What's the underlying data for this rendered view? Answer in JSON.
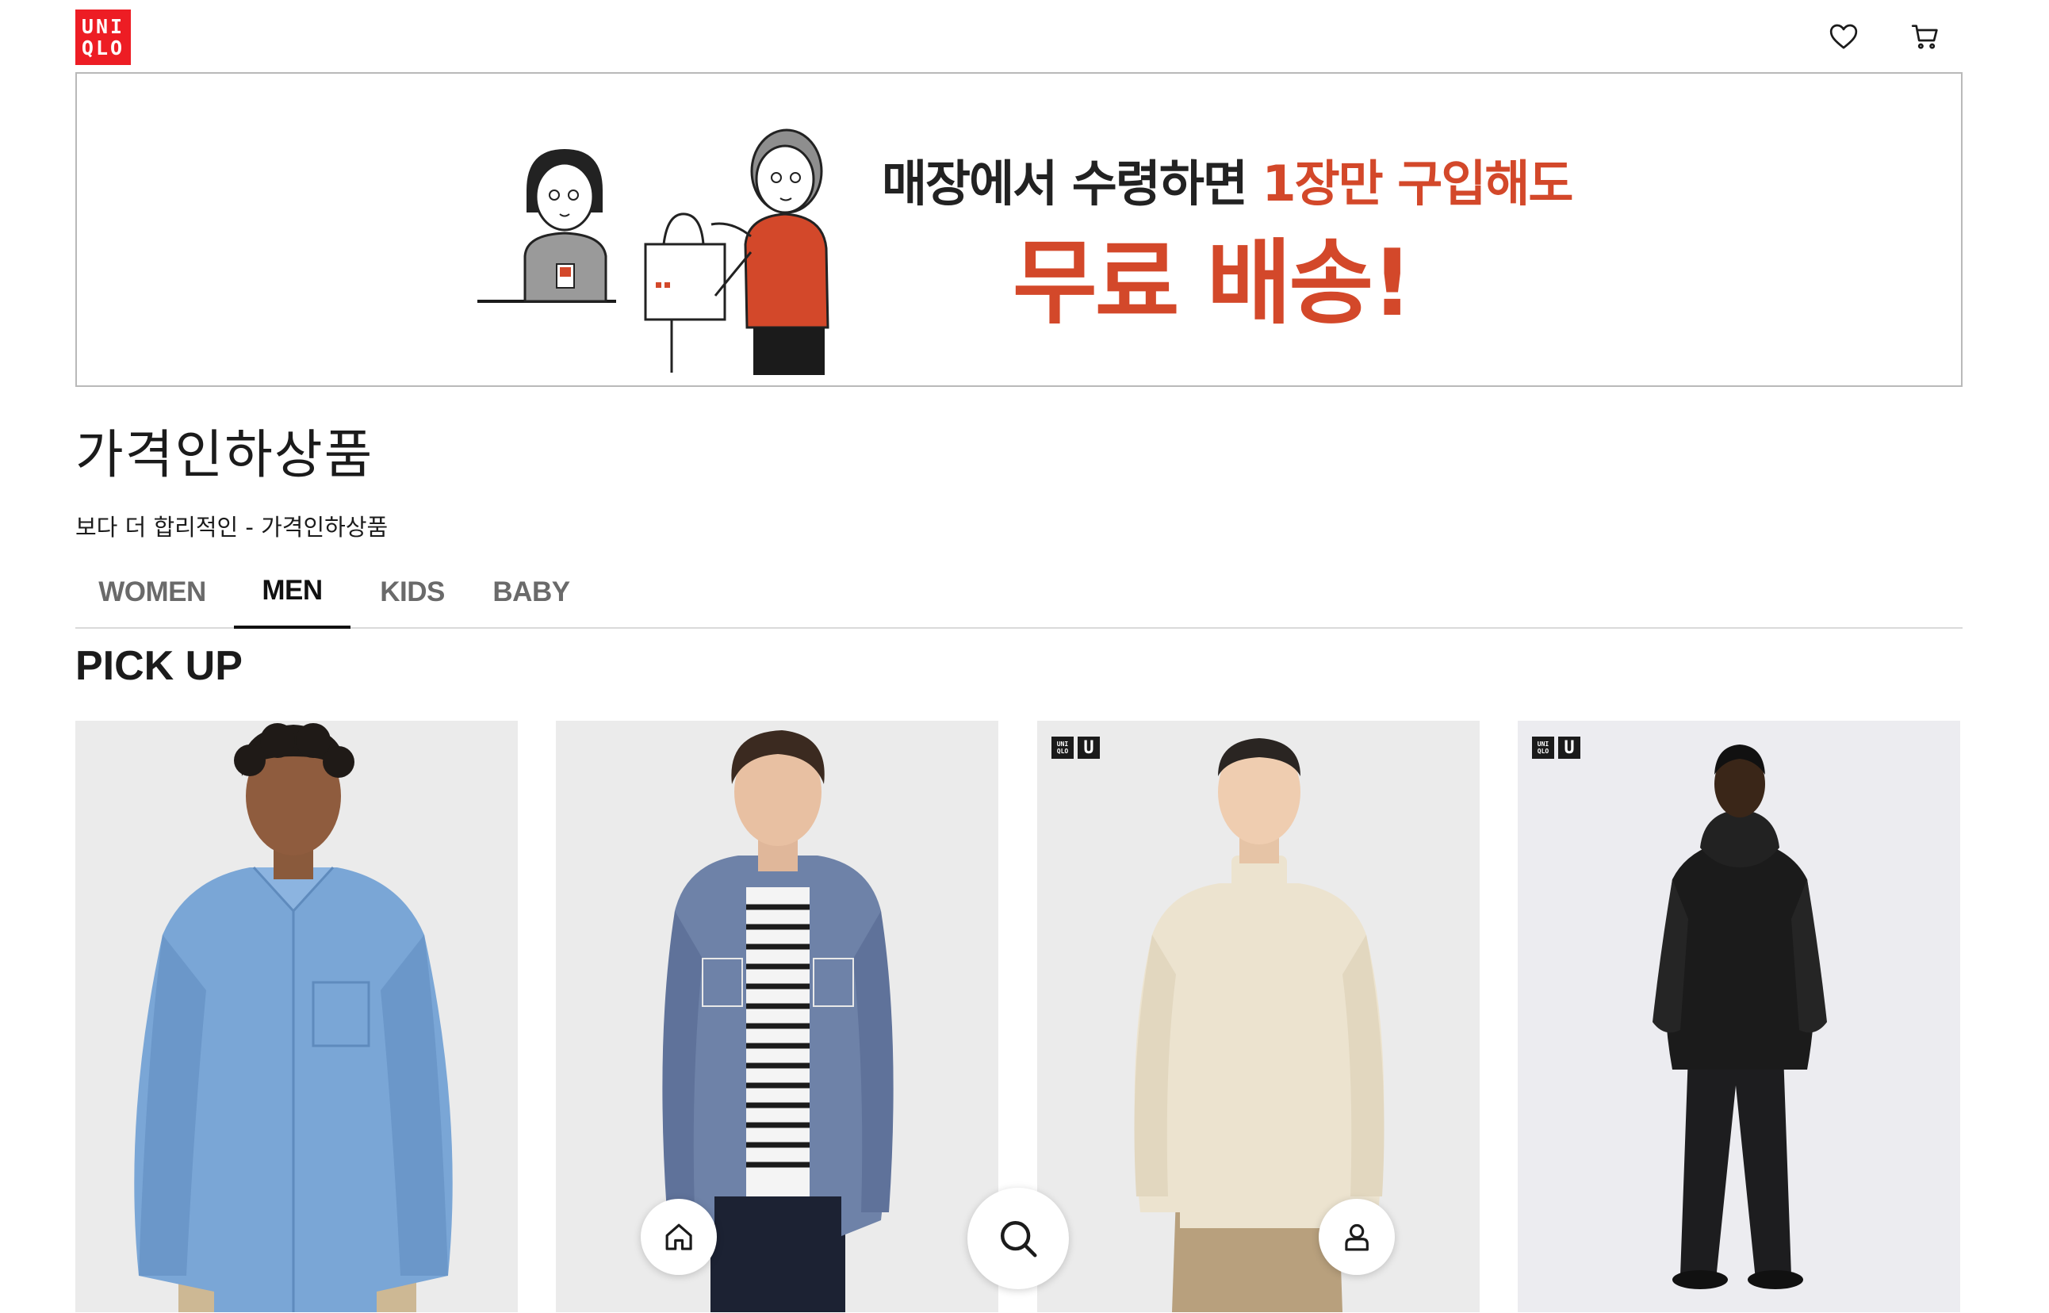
{
  "header": {
    "logo_line1": "UNI",
    "logo_line2": "QLO",
    "wishlist_icon": "heart-icon",
    "cart_icon": "cart-icon"
  },
  "banner": {
    "line1_dark": "매장에서 수령하면 ",
    "line1_accent": "1장만 구입해도",
    "line2": "무료 배송!",
    "accent_color": "#d3482a"
  },
  "page": {
    "title": "가격인하상품",
    "subtitle": "보다 더 합리적인 - 가격인하상품"
  },
  "tabs": [
    {
      "label": "WOMEN",
      "active": false
    },
    {
      "label": "MEN",
      "active": true
    },
    {
      "label": "KIDS",
      "active": false
    },
    {
      "label": "BABY",
      "active": false
    }
  ],
  "section": {
    "title": "PICK UP"
  },
  "products": [
    {
      "badge": false
    },
    {
      "badge": false
    },
    {
      "badge": true,
      "badge_logo_line1": "UNI",
      "badge_logo_line2": "QLO",
      "badge_u": "U"
    },
    {
      "badge": true,
      "badge_logo_line1": "UNI",
      "badge_logo_line2": "QLO",
      "badge_u": "U"
    }
  ],
  "floating_nav": {
    "home_icon": "home-icon",
    "search_icon": "search-icon",
    "account_icon": "user-icon"
  },
  "colors": {
    "brand_red": "#ed1d24",
    "text": "#1b1b1b",
    "tab_inactive": "#6a6a6a"
  }
}
